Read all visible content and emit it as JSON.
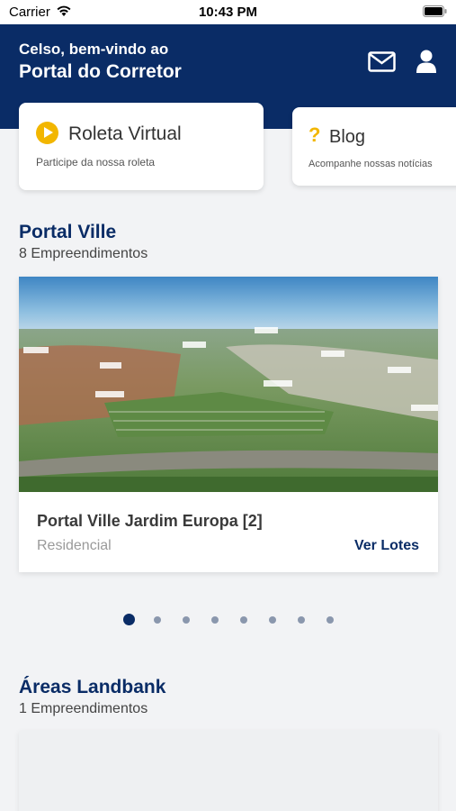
{
  "status_bar": {
    "carrier": "Carrier",
    "time": "10:43 PM"
  },
  "header": {
    "greeting": "Celso, bem-vindo ao",
    "title": "Portal do Corretor",
    "icons": [
      "mail-icon",
      "user-icon"
    ]
  },
  "quick_cards": [
    {
      "title": "Roleta Virtual",
      "subtitle": "Participe da nossa roleta",
      "icon": "play-icon"
    },
    {
      "title": "Blog",
      "subtitle": "Acompanhe nossas notícias",
      "icon": "question-icon"
    }
  ],
  "portal_ville": {
    "title": "Portal Ville",
    "count": "8 Empreendimentos",
    "card": {
      "name": "Portal Ville Jardim Europa [2]",
      "type": "Residencial",
      "link": "Ver Lotes"
    },
    "pagination": {
      "total": 8,
      "active": 1
    }
  },
  "landbank": {
    "title": "Áreas Landbank",
    "count": "1 Empreendimentos"
  },
  "colors": {
    "primary": "#0a2c66",
    "accent": "#f2b600",
    "background": "#f2f3f5"
  }
}
